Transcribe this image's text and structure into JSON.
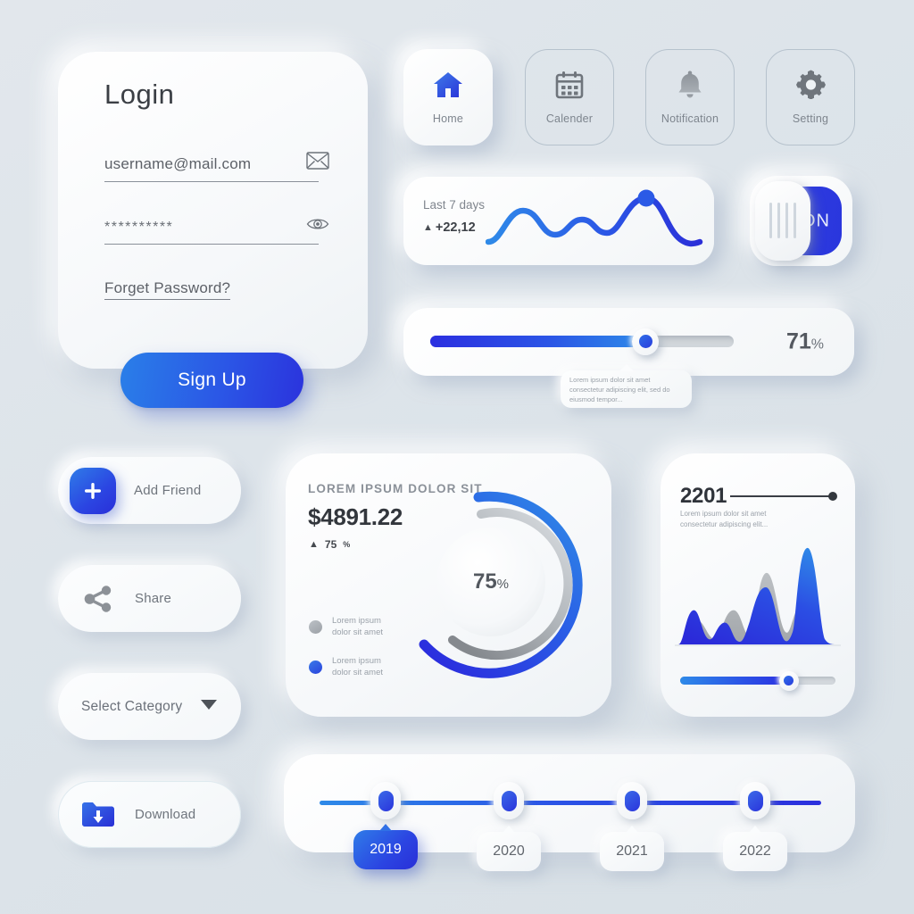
{
  "login": {
    "title": "Login",
    "email_value": "username@mail.com",
    "email_icon": "envelope-icon",
    "password_value": "**********",
    "password_icon": "eye-icon",
    "forget_link": "Forget Password?",
    "signup_label": "Sign Up"
  },
  "nav": {
    "items": [
      {
        "label": "Home",
        "icon": "home-icon",
        "active": true
      },
      {
        "label": "Calender",
        "icon": "calendar-icon",
        "active": false
      },
      {
        "label": "Notification",
        "icon": "bell-icon",
        "active": false
      },
      {
        "label": "Setting",
        "icon": "gear-icon",
        "active": false
      }
    ]
  },
  "sparkline": {
    "label": "Last 7 days",
    "triangle": "▲",
    "delta": "+22,12"
  },
  "toggle": {
    "state_label": "ON",
    "on": true
  },
  "slider": {
    "value": "71",
    "percent_symbol": "%",
    "fill_percent": 71,
    "tooltip": "Lorem ipsum dolor sit amet consectetur adipiscing elit, sed do eiusmod tempor..."
  },
  "actions": [
    {
      "label": "Add Friend",
      "icon": "plus-icon"
    },
    {
      "label": "Share",
      "icon": "share-icon"
    },
    {
      "label": "Select Category",
      "icon": "chevron-down-icon"
    },
    {
      "label": "Download",
      "icon": "folder-download-icon"
    }
  ],
  "donut_card": {
    "heading": "LOREM IPSUM DOLOR SIT",
    "amount": "$4891.22",
    "triangle": "▲",
    "change": "75",
    "change_symbol": "%",
    "center_value": "75",
    "center_symbol": "%",
    "legend": [
      {
        "line1": "Lorem ipsum",
        "line2": "dolor sit amet",
        "color": "#a8adb3"
      },
      {
        "line1": "Lorem ipsum",
        "line2": "dolor sit amet",
        "color": "#2f6ae6"
      }
    ]
  },
  "area_card": {
    "value": "2201",
    "subtitle": "Lorem ipsum dolor sit amet consectetur adipiscing elit...",
    "slider_percent": 70
  },
  "timeline": {
    "years": [
      {
        "label": "2019",
        "active": true
      },
      {
        "label": "2020",
        "active": false
      },
      {
        "label": "2021",
        "active": false
      },
      {
        "label": "2022",
        "active": false
      }
    ]
  },
  "chart_data": [
    {
      "type": "line",
      "title": "Last 7 days",
      "name": "sparkline",
      "x": [
        0,
        1,
        2,
        3,
        4,
        5,
        6
      ],
      "values": [
        8,
        44,
        18,
        34,
        20,
        72,
        10
      ],
      "ylabel": "",
      "xlabel": "",
      "marker_index": 5,
      "color": "#2b5ae6",
      "grid": false,
      "legend": "none"
    },
    {
      "type": "pie",
      "title": "LOREM IPSUM DOLOR SIT",
      "name": "donut-progress",
      "labels": [
        "Lorem ipsum dolor sit amet",
        "Lorem ipsum dolor sit amet"
      ],
      "values": [
        75,
        60
      ],
      "colors": [
        "#2b4ce4",
        "#8e949b"
      ],
      "center_label": "75%",
      "legend": "left"
    },
    {
      "type": "area",
      "title": "2201",
      "name": "area-comparison",
      "x": [
        0,
        1,
        2,
        3,
        4,
        5,
        6,
        7,
        8,
        9,
        10,
        11,
        12
      ],
      "series": [
        {
          "name": "primary",
          "color": "#2b3fe0",
          "values": [
            0,
            46,
            18,
            38,
            8,
            62,
            14,
            56,
            20,
            96,
            12,
            0,
            0
          ]
        },
        {
          "name": "secondary",
          "color": "#a0a4a8",
          "values": [
            0,
            20,
            36,
            14,
            50,
            22,
            82,
            30,
            46,
            16,
            0,
            0,
            0
          ]
        }
      ],
      "ylim": [
        0,
        100
      ],
      "grid": false,
      "legend": "none"
    }
  ]
}
